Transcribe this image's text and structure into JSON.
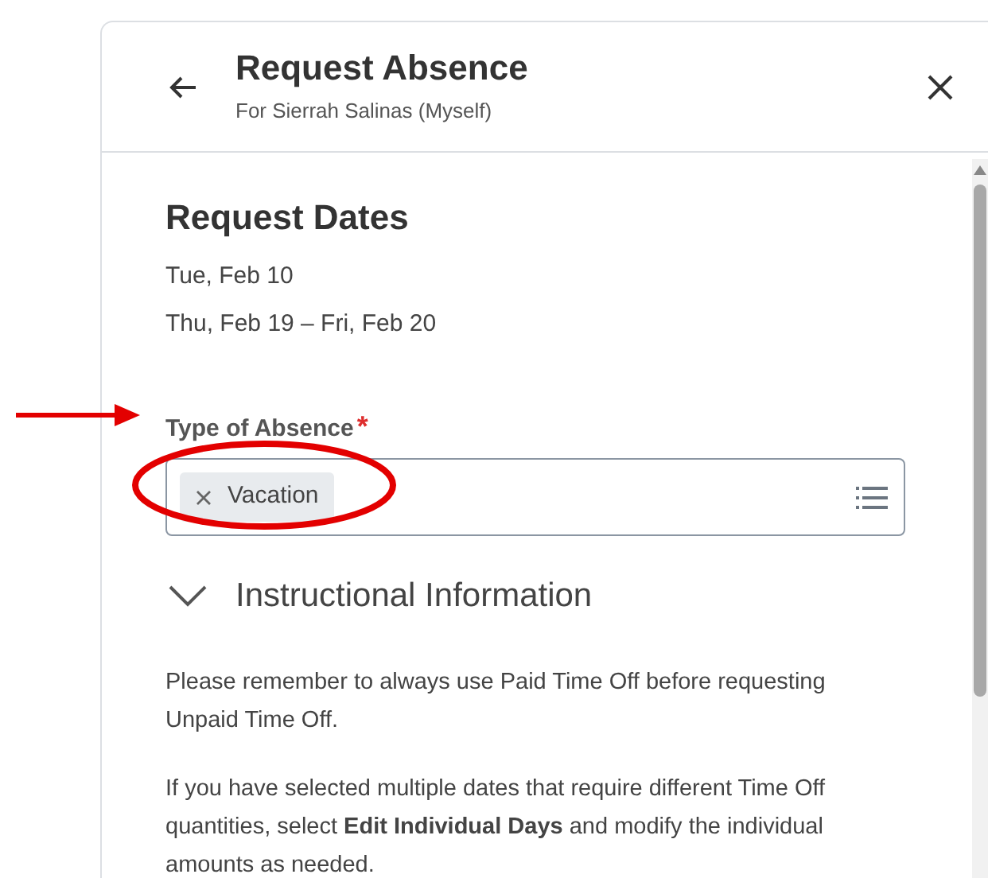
{
  "header": {
    "title": "Request Absence",
    "subtitle": "For Sierrah Salinas (Myself)"
  },
  "request_dates": {
    "title": "Request Dates",
    "dates": [
      "Tue, Feb 10",
      "Thu, Feb 19 – Fri, Feb 20"
    ]
  },
  "type_of_absence": {
    "label": "Type of Absence",
    "required_mark": "*",
    "selections": [
      "Vacation"
    ]
  },
  "instructional_information": {
    "title": "Instructional Information",
    "expanded": true,
    "paragraphs": [
      "Please remember to always use Paid Time Off before requesting Unpaid Time Off.",
      "If you have selected multiple dates that require different Time Off quantities, select **Edit Individual Days** and modify the individual amounts as needed."
    ]
  }
}
